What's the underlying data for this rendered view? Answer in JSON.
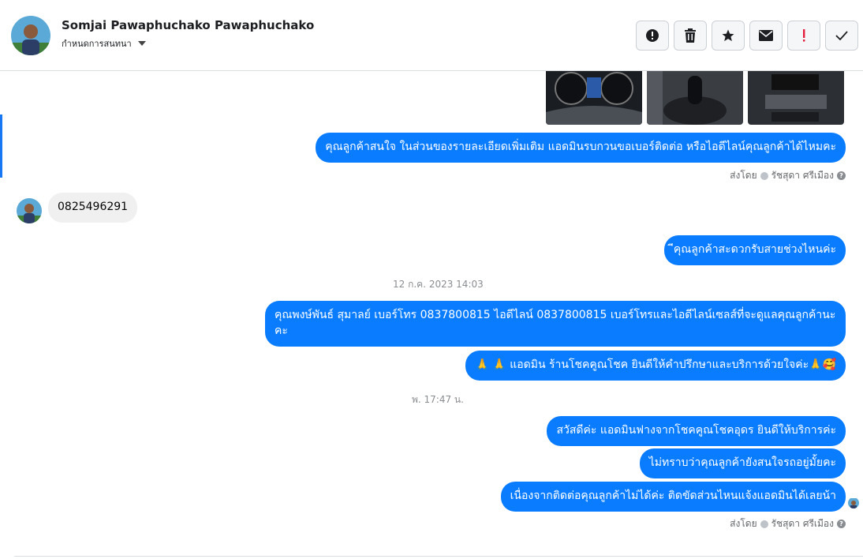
{
  "header": {
    "contact_name": "Somjai Pawaphuchako Pawaphuchako",
    "conversation_setting": "กำหนดการสนทนา"
  },
  "actions": {
    "spam": "exclamation-circle-icon",
    "delete": "trash-icon",
    "star": "star-icon",
    "unread": "envelope-icon",
    "priority": "red-exclamation-icon",
    "done": "checkmark-icon"
  },
  "messages": {
    "m1": "คุณลูกค้าสนใจ ในส่วนของรายละเอียดเพิ่มเติม แอดมินรบกวนขอเบอร์ติดต่อ หรือไอดีไลน์คุณลูกค้าได้ไหมคะ",
    "sent_by_label_1": "ส่งโดย",
    "sent_by_name_1": "รัชสุดา ศรีเมือง",
    "m2": "0825496291",
    "m3": "ีคุณลูกค้าสะดวกรับสายช่วงไหนค่ะ",
    "time_1": "12 ก.ค. 2023 14:03",
    "m4": "คุณพงษ์พันธ์ สุมาลย์      เบอร์โทร 0837800815  ไอดีไลน์ 0837800815   เบอร์โทรและไอดีไลน์เซลส์ที่จะดูแลคุณลูกค้านะคะ",
    "m5": "🙏 🙏 แอดมิน ร้านโชคคูณโชค ยินดีให้คำปรึกษาและบริการด้วยใจค่ะ🙏🥰",
    "time_2": "พ. 17:47 น.",
    "m6": "สวัสดีค่ะ แอดมินฟางจากโชคคูณโชคอุดร ยินดีให้บริการค่ะ",
    "m7": "ไม่ทราบว่าคุณลูกค้ายังสนใจรถอยู่มั้ยคะ",
    "m8": "เนื่องจากติดต่อคุณลูกค้าไม่ได้ค่ะ  ติดขัดส่วนไหนแจ้งแอดมินได้เลยน้า",
    "sent_by_label_2": "ส่งโดย",
    "sent_by_name_2": "รัชสุดา ศรีเมือง"
  },
  "colors": {
    "outgoing_bubble": "#0a7cff",
    "incoming_bubble": "#f0f0f0",
    "accent": "#1877f2",
    "priority_red": "#e41e3f"
  }
}
